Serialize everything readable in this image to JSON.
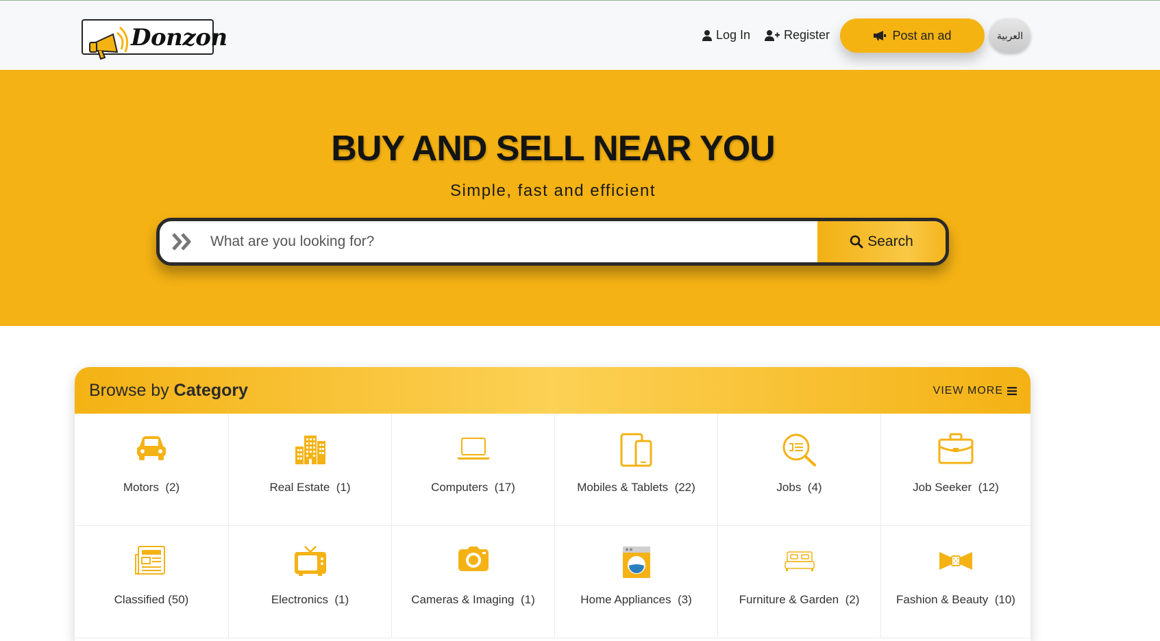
{
  "header": {
    "logo_text": "Donzon",
    "login_label": "Log In",
    "register_label": "Register",
    "post_ad_label": "Post an ad",
    "language_label": "العربية"
  },
  "hero": {
    "title": "BUY AND SELL NEAR YOU",
    "subtitle": "Simple, fast and efficient",
    "search_placeholder": "What are you looking for?",
    "search_label": "Search"
  },
  "categories": {
    "title_prefix": "Browse by",
    "title_bold": "Category",
    "view_more_label": "VIEW MORE",
    "items": [
      {
        "name": "Motors",
        "count": "(2)",
        "icon": "car-icon"
      },
      {
        "name": "Real Estate",
        "count": "(1)",
        "icon": "building-icon"
      },
      {
        "name": "Computers",
        "count": "(17)",
        "icon": "laptop-icon"
      },
      {
        "name": "Mobiles & Tablets",
        "count": "(22)",
        "icon": "mobile-tablet-icon"
      },
      {
        "name": "Jobs",
        "count": "(4)",
        "icon": "job-search-icon"
      },
      {
        "name": "Job Seeker",
        "count": "(12)",
        "icon": "briefcase-icon"
      },
      {
        "name": "Classified",
        "count": "(50)",
        "icon": "classified-icon"
      },
      {
        "name": "Electronics",
        "count": "(1)",
        "icon": "tv-icon"
      },
      {
        "name": "Cameras & Imaging",
        "count": "(1)",
        "icon": "camera-icon"
      },
      {
        "name": "Home Appliances",
        "count": "(3)",
        "icon": "washing-machine-icon"
      },
      {
        "name": "Furniture & Garden",
        "count": "(2)",
        "icon": "bed-icon"
      },
      {
        "name": "Fashion & Beauty",
        "count": "(10)",
        "icon": "bow-tie-icon"
      }
    ]
  },
  "colors": {
    "accent": "#f4b214",
    "dark": "#222222"
  }
}
